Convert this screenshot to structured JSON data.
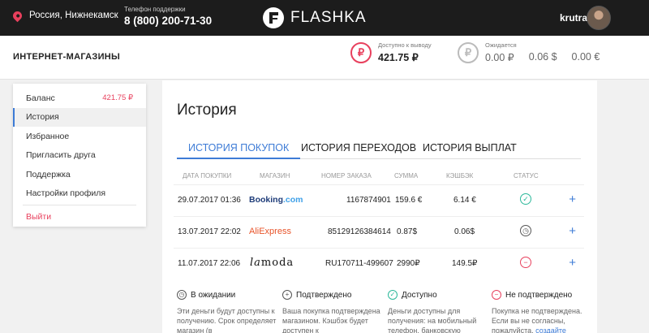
{
  "header": {
    "city": "Россия, Нижнекамск",
    "phone_label": "Телефон поддержки",
    "phone": "8 (800) 200-71-30",
    "brand": "FLASHKA",
    "username": "krutraf"
  },
  "subheader": {
    "title": "ИНТЕРНЕТ-МАГАЗИНЫ",
    "available_label": "Доступно к выводу",
    "available_value": "421.75 ₽",
    "expected_label": "Ожидается",
    "expected_values": [
      "0.00 ₽",
      "0.06 $",
      "0.00 €"
    ]
  },
  "sidebar": {
    "balance_label": "Баланс",
    "balance_value": "421.75 ₽",
    "items": [
      "История",
      "Избранное",
      "Пригласить друга",
      "Поддержка",
      "Настройки профиля"
    ],
    "logout": "Выйти",
    "active": "История"
  },
  "main": {
    "title": "История",
    "tabs": [
      "ИСТОРИЯ ПОКУПОК",
      "ИСТОРИЯ ПЕРЕХОДОВ",
      "ИСТОРИЯ ВЫПЛАТ"
    ],
    "columns": [
      "ДАТА ПОКУПКИ",
      "МАГАЗИН",
      "НОМЕР ЗАКАЗА",
      "СУММА",
      "КЭШБЭК",
      "СТАТУС"
    ],
    "rows": [
      {
        "date": "29.07.2017 01:36",
        "store_a": "Booking",
        "store_b": ".com",
        "order": "1167874901",
        "sum": "159.6 €",
        "cashback": "6.14 €",
        "status": "ok"
      },
      {
        "date": "13.07.2017 22:02",
        "store_a": "AliExpress",
        "store_b": "",
        "order": "85129126384614",
        "sum": "0.87$",
        "cashback": "0.06$",
        "status": "wait"
      },
      {
        "date": "11.07.2017 22:06",
        "store_a": "la",
        "store_b": "moda",
        "order": "RU170711-499607",
        "sum": "2990₽",
        "cashback": "149.5₽",
        "status": "no"
      }
    ]
  },
  "legend": [
    {
      "title": "В ожидании",
      "text": "Эти деньги будут доступны к получению. Срок определяет магазин (в"
    },
    {
      "title": "Подтверждено",
      "text": "Ваша покупка подтверждена магазином. Кэшбэк будет доступен к"
    },
    {
      "title": "Доступно",
      "text": "Деньги доступны для получения: на мобильный телефон, банковскую"
    },
    {
      "title": "Не подтверждено",
      "text": "Покупка не подтверждена. Если вы не согласны, пожалуйста,",
      "link": "создайте"
    }
  ],
  "colors": {
    "accent": "#3d7bd6",
    "pink": "#e8405d",
    "green": "#2bb89a",
    "topbar": "#1c1c1c"
  }
}
